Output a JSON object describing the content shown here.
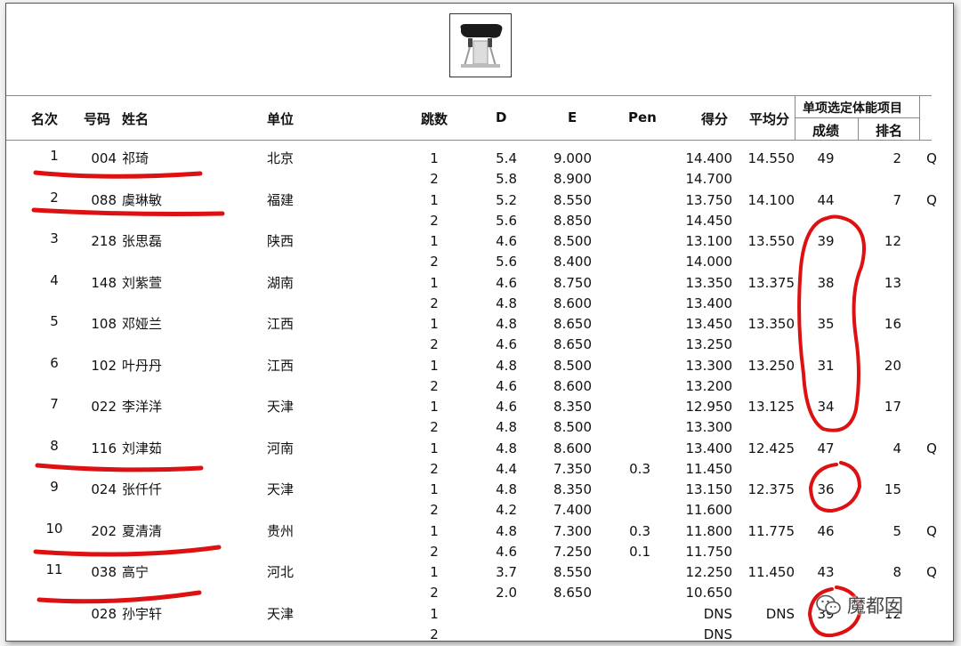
{
  "headers": {
    "rank": "名次",
    "bib": "号码",
    "name": "姓名",
    "unit": "单位",
    "jump": "跳数",
    "d": "D",
    "e": "E",
    "pen": "Pen",
    "score": "得分",
    "avg": "平均分",
    "fitness": "单项选定体能项目",
    "fitness_score": "成绩",
    "fitness_rank": "排名"
  },
  "athletes": [
    {
      "rank": "1",
      "bib": "004",
      "name": "祁琦",
      "unit": "北京",
      "avg": "14.550",
      "fit_score": "49",
      "fit_rank": "2",
      "q": "Q",
      "jumps": [
        {
          "n": "1",
          "d": "5.4",
          "e": "9.000",
          "pen": "",
          "score": "14.400"
        },
        {
          "n": "2",
          "d": "5.8",
          "e": "8.900",
          "pen": "",
          "score": "14.700"
        }
      ]
    },
    {
      "rank": "2",
      "bib": "088",
      "name": "虞琳敏",
      "unit": "福建",
      "avg": "14.100",
      "fit_score": "44",
      "fit_rank": "7",
      "q": "Q",
      "jumps": [
        {
          "n": "1",
          "d": "5.2",
          "e": "8.550",
          "pen": "",
          "score": "13.750"
        },
        {
          "n": "2",
          "d": "5.6",
          "e": "8.850",
          "pen": "",
          "score": "14.450"
        }
      ]
    },
    {
      "rank": "3",
      "bib": "218",
      "name": "张思磊",
      "unit": "陕西",
      "avg": "13.550",
      "fit_score": "39",
      "fit_rank": "12",
      "q": "",
      "jumps": [
        {
          "n": "1",
          "d": "4.6",
          "e": "8.500",
          "pen": "",
          "score": "13.100"
        },
        {
          "n": "2",
          "d": "5.6",
          "e": "8.400",
          "pen": "",
          "score": "14.000"
        }
      ]
    },
    {
      "rank": "4",
      "bib": "148",
      "name": "刘紫萱",
      "unit": "湖南",
      "avg": "13.375",
      "fit_score": "38",
      "fit_rank": "13",
      "q": "",
      "jumps": [
        {
          "n": "1",
          "d": "4.6",
          "e": "8.750",
          "pen": "",
          "score": "13.350"
        },
        {
          "n": "2",
          "d": "4.8",
          "e": "8.600",
          "pen": "",
          "score": "13.400"
        }
      ]
    },
    {
      "rank": "5",
      "bib": "108",
      "name": "邓娅兰",
      "unit": "江西",
      "avg": "13.350",
      "fit_score": "35",
      "fit_rank": "16",
      "q": "",
      "jumps": [
        {
          "n": "1",
          "d": "4.8",
          "e": "8.650",
          "pen": "",
          "score": "13.450"
        },
        {
          "n": "2",
          "d": "4.6",
          "e": "8.650",
          "pen": "",
          "score": "13.250"
        }
      ]
    },
    {
      "rank": "6",
      "bib": "102",
      "name": "叶丹丹",
      "unit": "江西",
      "avg": "13.250",
      "fit_score": "31",
      "fit_rank": "20",
      "q": "",
      "jumps": [
        {
          "n": "1",
          "d": "4.8",
          "e": "8.500",
          "pen": "",
          "score": "13.300"
        },
        {
          "n": "2",
          "d": "4.6",
          "e": "8.600",
          "pen": "",
          "score": "13.200"
        }
      ]
    },
    {
      "rank": "7",
      "bib": "022",
      "name": "李洋洋",
      "unit": "天津",
      "avg": "13.125",
      "fit_score": "34",
      "fit_rank": "17",
      "q": "",
      "jumps": [
        {
          "n": "1",
          "d": "4.6",
          "e": "8.350",
          "pen": "",
          "score": "12.950"
        },
        {
          "n": "2",
          "d": "4.8",
          "e": "8.500",
          "pen": "",
          "score": "13.300"
        }
      ]
    },
    {
      "rank": "8",
      "bib": "116",
      "name": "刘津茹",
      "unit": "河南",
      "avg": "12.425",
      "fit_score": "47",
      "fit_rank": "4",
      "q": "Q",
      "jumps": [
        {
          "n": "1",
          "d": "4.8",
          "e": "8.600",
          "pen": "",
          "score": "13.400"
        },
        {
          "n": "2",
          "d": "4.4",
          "e": "7.350",
          "pen": "0.3",
          "score": "11.450"
        }
      ]
    },
    {
      "rank": "9",
      "bib": "024",
      "name": "张仟仟",
      "unit": "天津",
      "avg": "12.375",
      "fit_score": "36",
      "fit_rank": "15",
      "q": "",
      "jumps": [
        {
          "n": "1",
          "d": "4.8",
          "e": "8.350",
          "pen": "",
          "score": "13.150"
        },
        {
          "n": "2",
          "d": "4.2",
          "e": "7.400",
          "pen": "",
          "score": "11.600"
        }
      ]
    },
    {
      "rank": "10",
      "bib": "202",
      "name": "夏清清",
      "unit": "贵州",
      "avg": "11.775",
      "fit_score": "46",
      "fit_rank": "5",
      "q": "Q",
      "jumps": [
        {
          "n": "1",
          "d": "4.8",
          "e": "7.300",
          "pen": "0.3",
          "score": "11.800"
        },
        {
          "n": "2",
          "d": "4.6",
          "e": "7.250",
          "pen": "0.1",
          "score": "11.750"
        }
      ]
    },
    {
      "rank": "11",
      "bib": "038",
      "name": "高宁",
      "unit": "河北",
      "avg": "11.450",
      "fit_score": "43",
      "fit_rank": "8",
      "q": "Q",
      "jumps": [
        {
          "n": "1",
          "d": "3.7",
          "e": "8.550",
          "pen": "",
          "score": "12.250"
        },
        {
          "n": "2",
          "d": "2.0",
          "e": "8.650",
          "pen": "",
          "score": "10.650"
        }
      ]
    },
    {
      "rank": "",
      "bib": "028",
      "name": "孙宇轩",
      "unit": "天津",
      "avg": "DNS",
      "fit_score": "39",
      "fit_rank": "12",
      "q": "",
      "jumps": [
        {
          "n": "1",
          "d": "",
          "e": "",
          "pen": "",
          "score": "DNS"
        },
        {
          "n": "2",
          "d": "",
          "e": "",
          "pen": "",
          "score": "DNS"
        }
      ]
    }
  ],
  "watermark": {
    "text": "魔都囡",
    "icon": "wechat-icon"
  },
  "logo": {
    "icon": "vault-table-icon"
  },
  "annotation_color": "#dd1111"
}
